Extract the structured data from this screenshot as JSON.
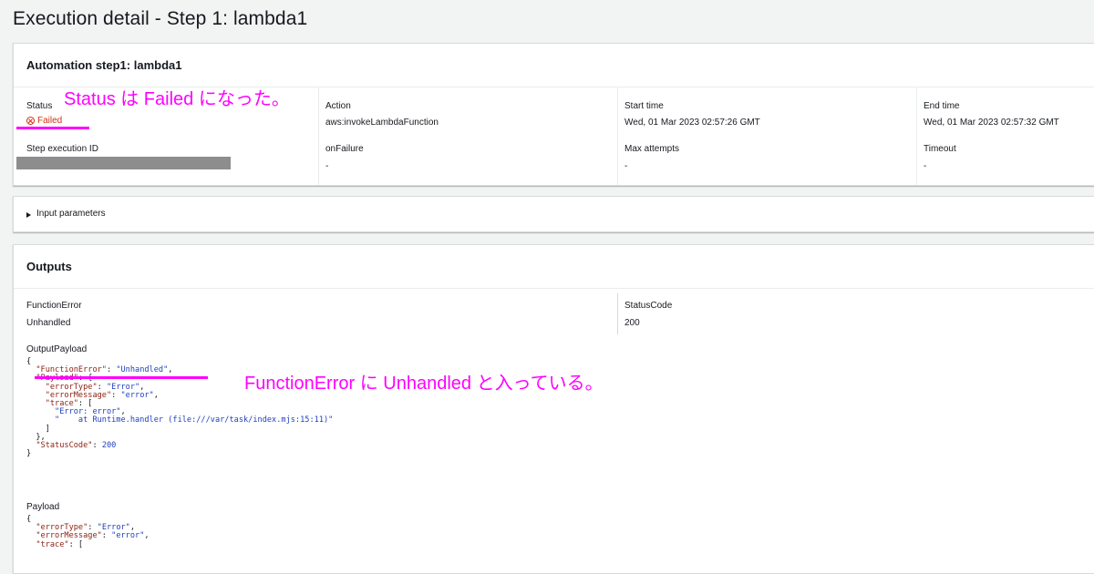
{
  "page": {
    "title": "Execution detail - Step 1: lambda1"
  },
  "step_panel": {
    "header": "Automation step1: lambda1",
    "status_label": "Status",
    "status_value": "Failed",
    "action_label": "Action",
    "action_value": "aws:invokeLambdaFunction",
    "start_time_label": "Start time",
    "start_time_value": "Wed, 01 Mar 2023 02:57:26 GMT",
    "end_time_label": "End time",
    "end_time_value": "Wed, 01 Mar 2023 02:57:32 GMT",
    "step_execution_id_label": "Step execution ID",
    "on_failure_label": "onFailure",
    "on_failure_value": "-",
    "max_attempts_label": "Max attempts",
    "max_attempts_value": "-",
    "timeout_label": "Timeout",
    "timeout_value": "-"
  },
  "input_panel": {
    "label": "Input parameters"
  },
  "outputs_panel": {
    "header": "Outputs",
    "function_error_label": "FunctionError",
    "function_error_value": "Unhandled",
    "status_code_label": "StatusCode",
    "status_code_value": "200",
    "output_payload_label": "OutputPayload",
    "payload_label": "Payload",
    "output_payload_lines": [
      "{",
      "  \"FunctionError\": \"Unhandled\",",
      "  \"Payload\": {",
      "    \"errorType\": \"Error\",",
      "    \"errorMessage\": \"error\",",
      "    \"trace\": [",
      "      \"Error: error\",",
      "      \"    at Runtime.handler (file:///var/task/index.mjs:15:11)\"",
      "    ]",
      "  },",
      "  \"StatusCode\": 200",
      "}"
    ],
    "payload_lines": [
      "{",
      "  \"errorType\": \"Error\",",
      "  \"errorMessage\": \"error\",",
      "  \"trace\": ["
    ]
  },
  "annotations": {
    "status_note": "Status は Failed になった。",
    "function_error_note": "FunctionError に Unhandled  と入っている。",
    "color": "#ff00ff"
  },
  "colors": {
    "failed": "#d13212",
    "background": "#f2f3f3",
    "panel_border": "#d5dbdb"
  }
}
